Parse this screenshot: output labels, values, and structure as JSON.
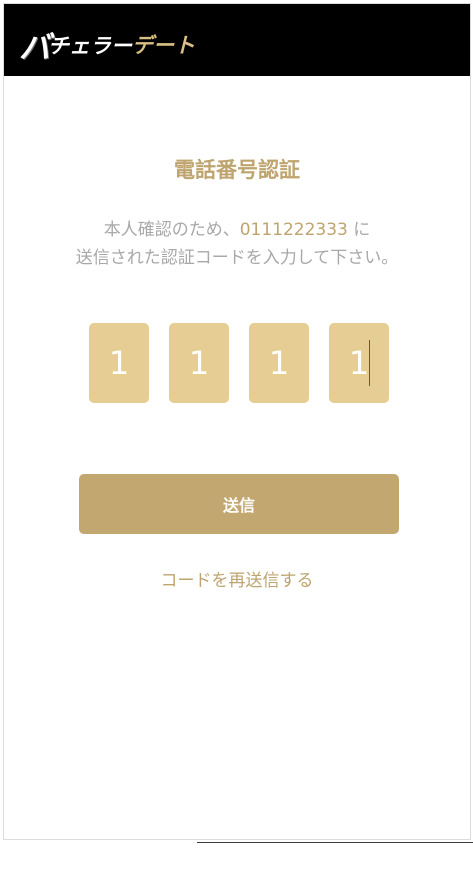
{
  "header": {
    "logo_initial": "バ",
    "logo_white": "チェラー",
    "logo_gold": "デート"
  },
  "title": "電話番号認証",
  "description": {
    "line1_prefix": "本人確認のため、",
    "phone_number": "0111222333",
    "line1_suffix": " に",
    "line2": "送信された認証コードを入力して下さい。"
  },
  "code": {
    "digits": [
      "1",
      "1",
      "1",
      "1"
    ],
    "active_index": 3
  },
  "submit_label": "送信",
  "resend_label": "コードを再送信する",
  "colors": {
    "header_bg": "#000000",
    "accent_gold": "#bea46e",
    "box_fill": "#e6cd93",
    "button_fill": "#c3a770",
    "text_gray": "#a8a8a8"
  }
}
